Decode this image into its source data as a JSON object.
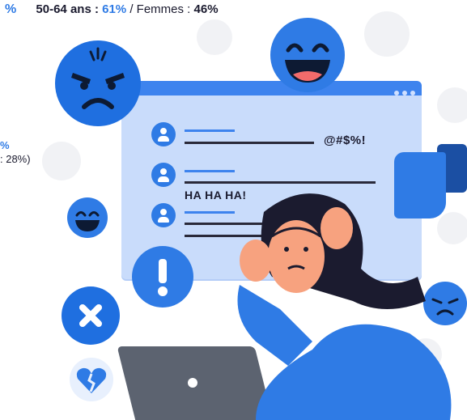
{
  "stats": {
    "top_prefix": "%",
    "age_label": "50-64 ans :",
    "age_value": "61%",
    "separator": "/",
    "women_label": "Femmes :",
    "women_value": "46%",
    "left_fragment_pct": "%",
    "left_fragment_text": ": 28%)"
  },
  "chat": {
    "message_1": "@#$%!",
    "message_2": "HA HA HA!"
  },
  "colors": {
    "accent": "#2f7be5",
    "window": "#c9dcfb",
    "dark": "#1b1b2f"
  }
}
